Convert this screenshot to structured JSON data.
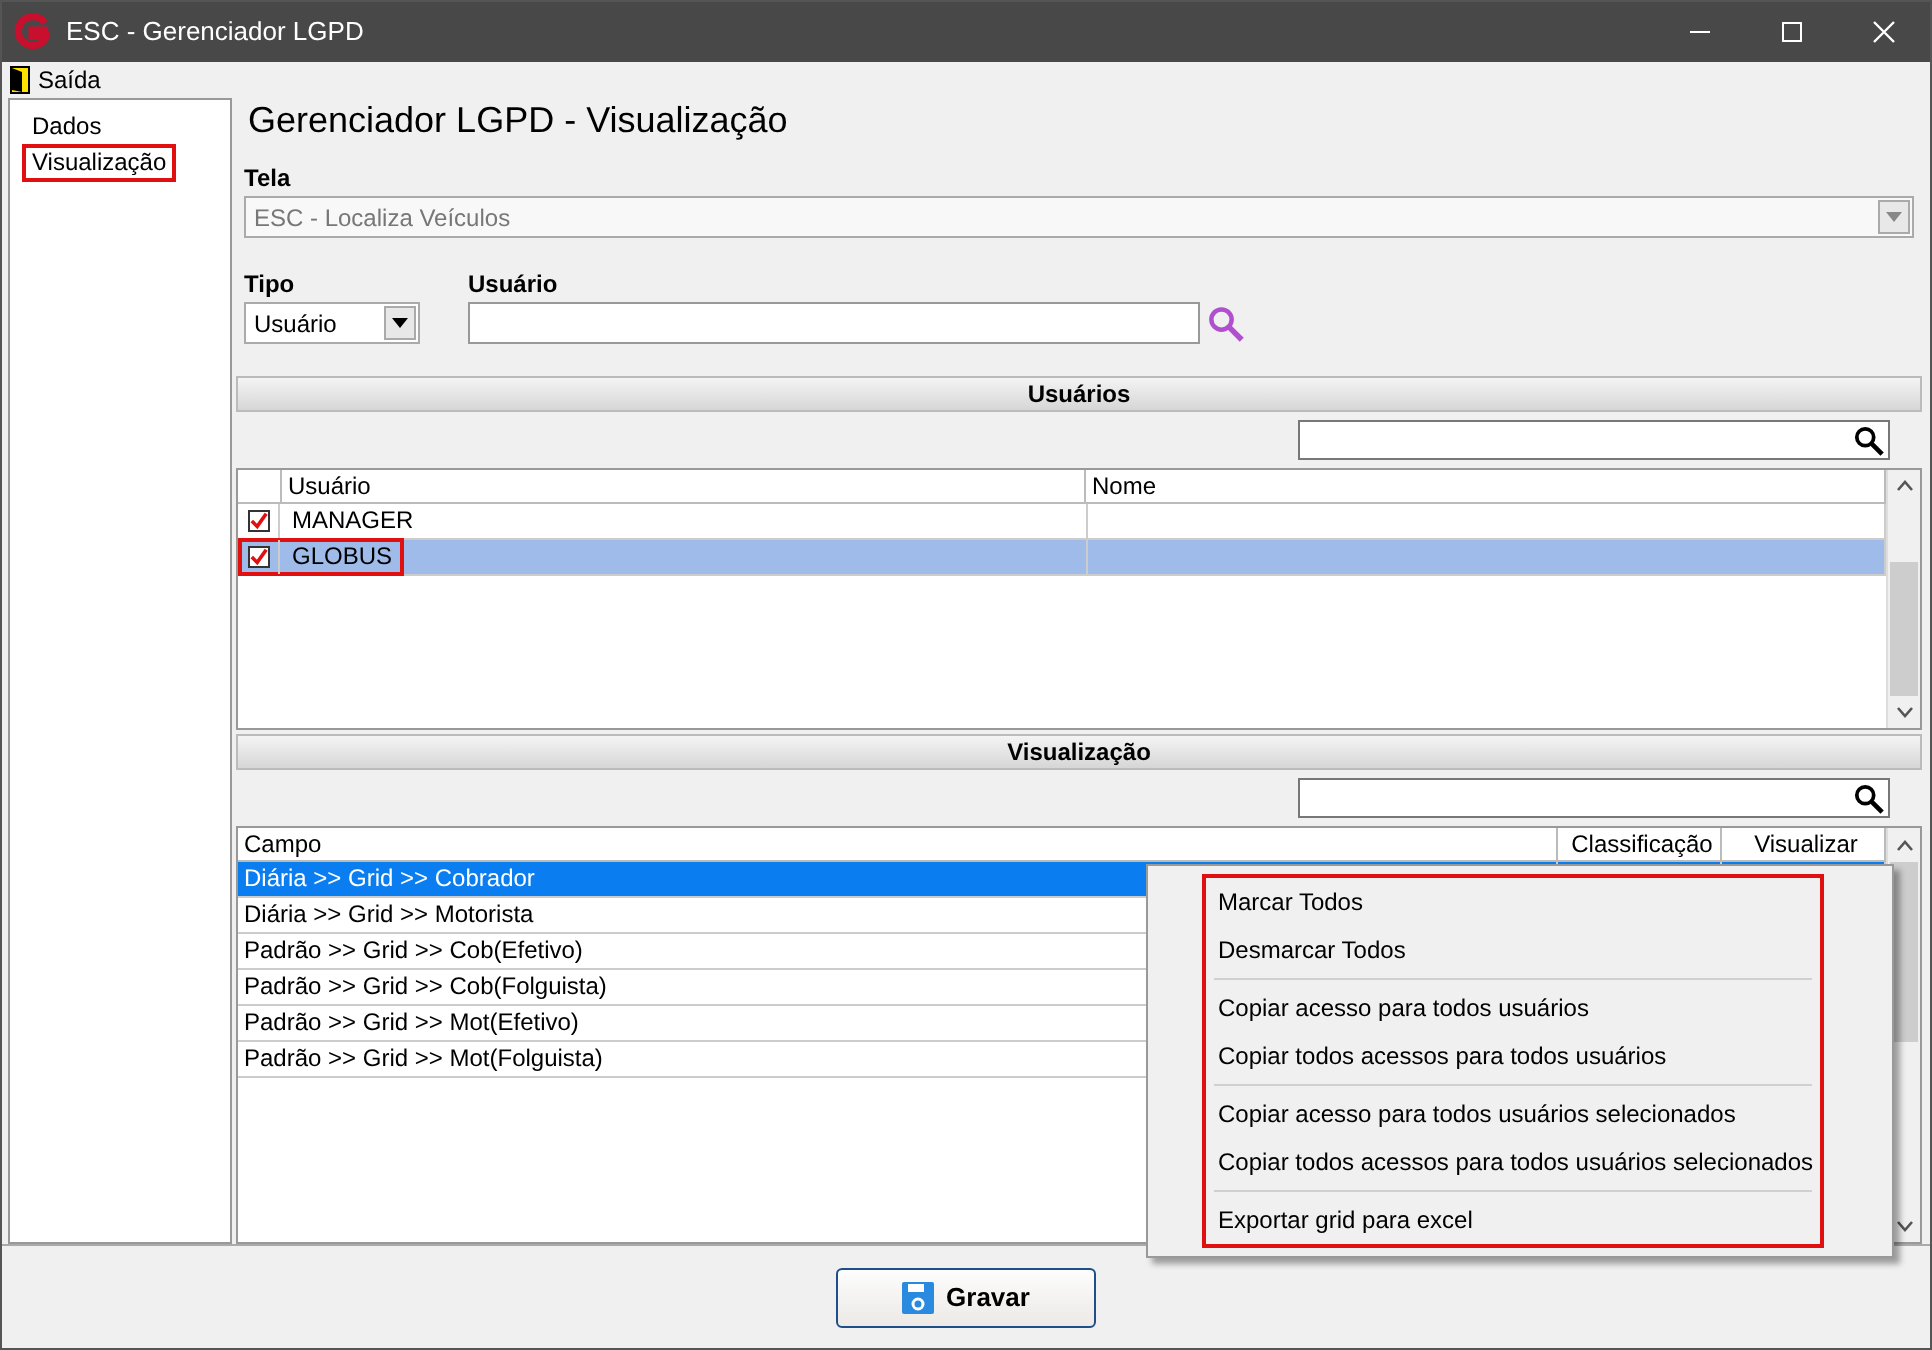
{
  "window": {
    "title": "ESC - Gerenciador LGPD"
  },
  "menu": [
    {
      "label": "Saída"
    }
  ],
  "sidebar": {
    "items": [
      {
        "label": "Dados",
        "highlighted": false
      },
      {
        "label": "Visualização",
        "highlighted": true
      }
    ]
  },
  "heading": "Gerenciador LGPD - Visualização",
  "tela": {
    "label": "Tela",
    "value": "ESC - Localiza Veículos",
    "disabled": true
  },
  "tipo": {
    "label": "Tipo",
    "value": "Usuário"
  },
  "usuario": {
    "label": "Usuário"
  },
  "users_panel": {
    "title": "Usuários",
    "columns": [
      "Usuário",
      "Nome"
    ],
    "rows": [
      {
        "checked": true,
        "usuario": "MANAGER",
        "selected": false,
        "highlighted": false
      },
      {
        "checked": true,
        "usuario": "GLOBUS",
        "selected": true,
        "highlighted": true
      }
    ]
  },
  "fields_panel": {
    "title": "Visualização",
    "columns": [
      "Campo",
      "Classificação",
      "Visualizar"
    ],
    "rows": [
      {
        "campo": "Diária >> Grid >> Cobrador",
        "selected": true
      },
      {
        "campo": "Diária >> Grid >> Motorista",
        "selected": false
      },
      {
        "campo": "Padrão >> Grid >> Cob(Efetivo)",
        "selected": false
      },
      {
        "campo": "Padrão >> Grid >> Cob(Folguista)",
        "selected": false
      },
      {
        "campo": "Padrão >> Grid >> Mot(Efetivo)",
        "selected": false
      },
      {
        "campo": "Padrão >> Grid >> Mot(Folguista)",
        "selected": false
      }
    ]
  },
  "context_menu": {
    "highlighted": true,
    "items": [
      {
        "kind": "item",
        "label": "Marcar Todos"
      },
      {
        "kind": "item",
        "label": "Desmarcar Todos"
      },
      {
        "kind": "separator"
      },
      {
        "kind": "item",
        "label": "Copiar acesso para todos usuários"
      },
      {
        "kind": "item",
        "label": "Copiar todos acessos para todos usuários"
      },
      {
        "kind": "separator"
      },
      {
        "kind": "item",
        "label": "Copiar acesso para todos usuários selecionados"
      },
      {
        "kind": "item",
        "label": "Copiar todos acessos para todos usuários selecionados"
      },
      {
        "kind": "separator"
      },
      {
        "kind": "item",
        "label": "Exportar grid para excel"
      }
    ]
  },
  "save_button": {
    "label": "Gravar"
  }
}
